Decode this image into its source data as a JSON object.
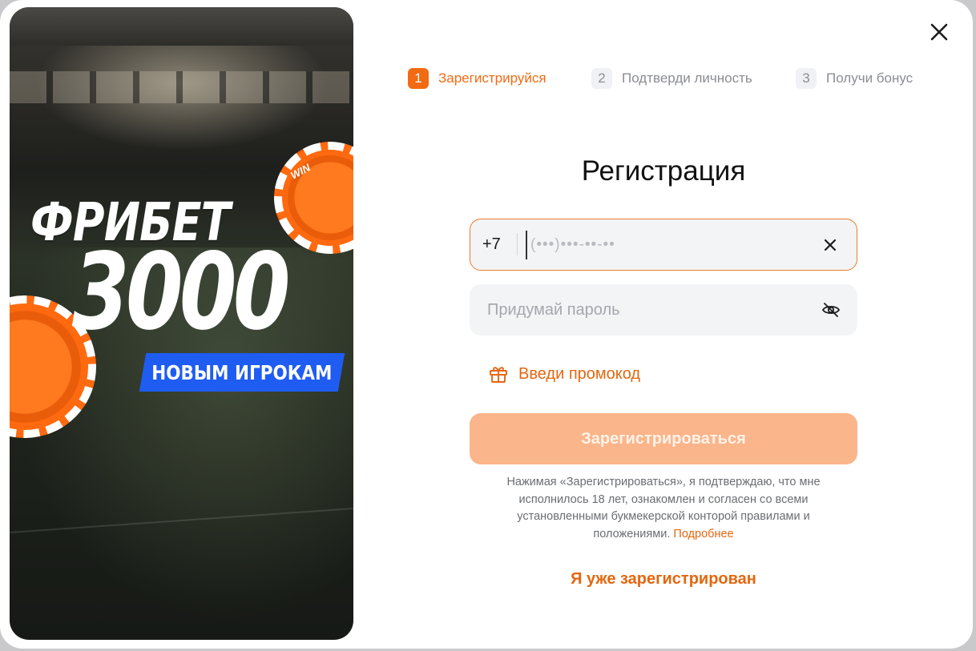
{
  "promo": {
    "title": "ФРИБЕТ",
    "amount": "3000",
    "badge": "НОВЫМ ИГРОКАМ",
    "chip_text": "WIN"
  },
  "close": {
    "icon": "close-icon"
  },
  "steps": [
    {
      "number": "1",
      "label": "Зарегистрируйся",
      "state": "active"
    },
    {
      "number": "2",
      "label": "Подтверди личность",
      "state": "inactive"
    },
    {
      "number": "3",
      "label": "Получи бонус",
      "state": "inactive"
    }
  ],
  "form": {
    "title": "Регистрация",
    "phone": {
      "prefix": "+7",
      "value": "",
      "placeholder": "(•••)•••-••-••",
      "clear_icon": "close-icon"
    },
    "password": {
      "value": "",
      "placeholder": "Придумай пароль",
      "toggle_icon": "eye-off-icon"
    },
    "promo_code": {
      "label": "Введи промокод",
      "icon": "gift-icon"
    },
    "submit_label": "Зарегистрироваться",
    "legal_text": "Нажимая «Зарегистрироваться», я подтверждаю, что мне исполнилось 18 лет, ознакомлен и согласен со всеми установленными букмекерской конторой правилами и положениями.",
    "legal_link": "Подробнее",
    "login_link": "Я уже зарегистрирован"
  },
  "colors": {
    "accent": "#f26a12",
    "accent_text": "#e4670f",
    "button_disabled": "#fbb58a",
    "badge_blue": "#1f5cf2"
  }
}
